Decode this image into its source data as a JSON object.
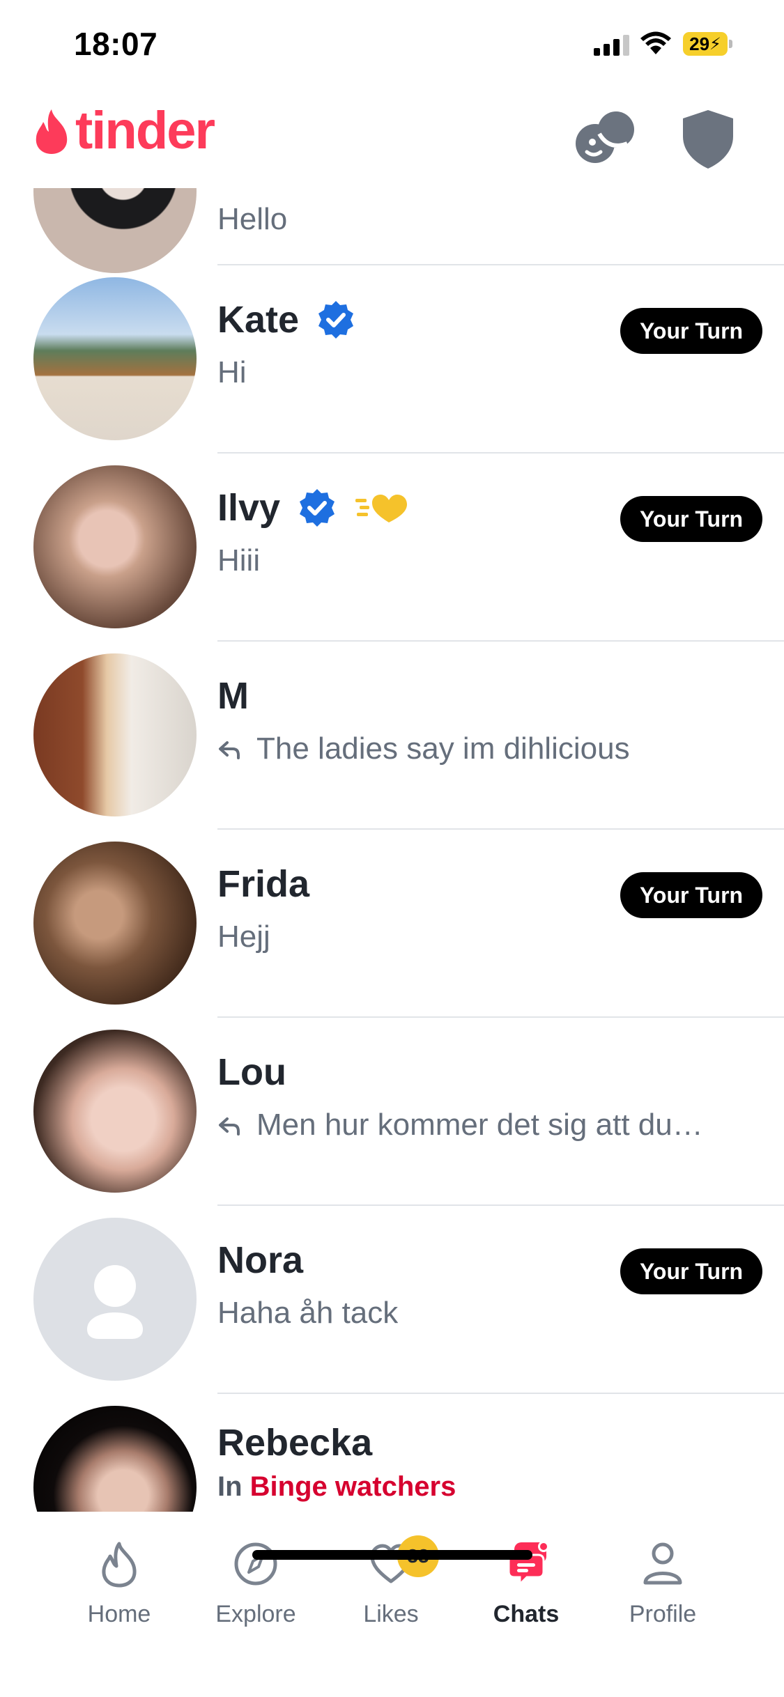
{
  "status_bar": {
    "time": "18:07",
    "battery": "29"
  },
  "header": {
    "logo_text": "tinder"
  },
  "chats": [
    {
      "name": "",
      "message": "Hello",
      "your_turn": false
    },
    {
      "name": "Kate",
      "message": "Hi",
      "your_turn": true,
      "verified": true
    },
    {
      "name": "Ilvy",
      "message": "Hiii",
      "your_turn": true,
      "verified": true,
      "super_like": true
    },
    {
      "name": "M",
      "message": "The ladies say im dihlicious",
      "your_turn": false,
      "replied": true
    },
    {
      "name": "Frida",
      "message": "Hejj",
      "your_turn": true
    },
    {
      "name": "Lou",
      "message": "Men hur kommer det sig att du…",
      "your_turn": false,
      "replied": true
    },
    {
      "name": "Nora",
      "message": "Haha åh tack",
      "your_turn": true,
      "no_photo": true
    },
    {
      "name": "Rebecka",
      "in_prefix": "In",
      "group": "Binge watchers",
      "your_turn": false
    }
  ],
  "your_turn_label": "Your Turn",
  "tab_bar": {
    "home": "Home",
    "explore": "Explore",
    "likes": "Likes",
    "likes_count": "33",
    "chats": "Chats",
    "profile": "Profile"
  },
  "colors": {
    "brand": "#fd3b5a",
    "verified": "#1e6fe0",
    "accent_group": "#d6002f",
    "likes_badge": "#f5c22b"
  }
}
